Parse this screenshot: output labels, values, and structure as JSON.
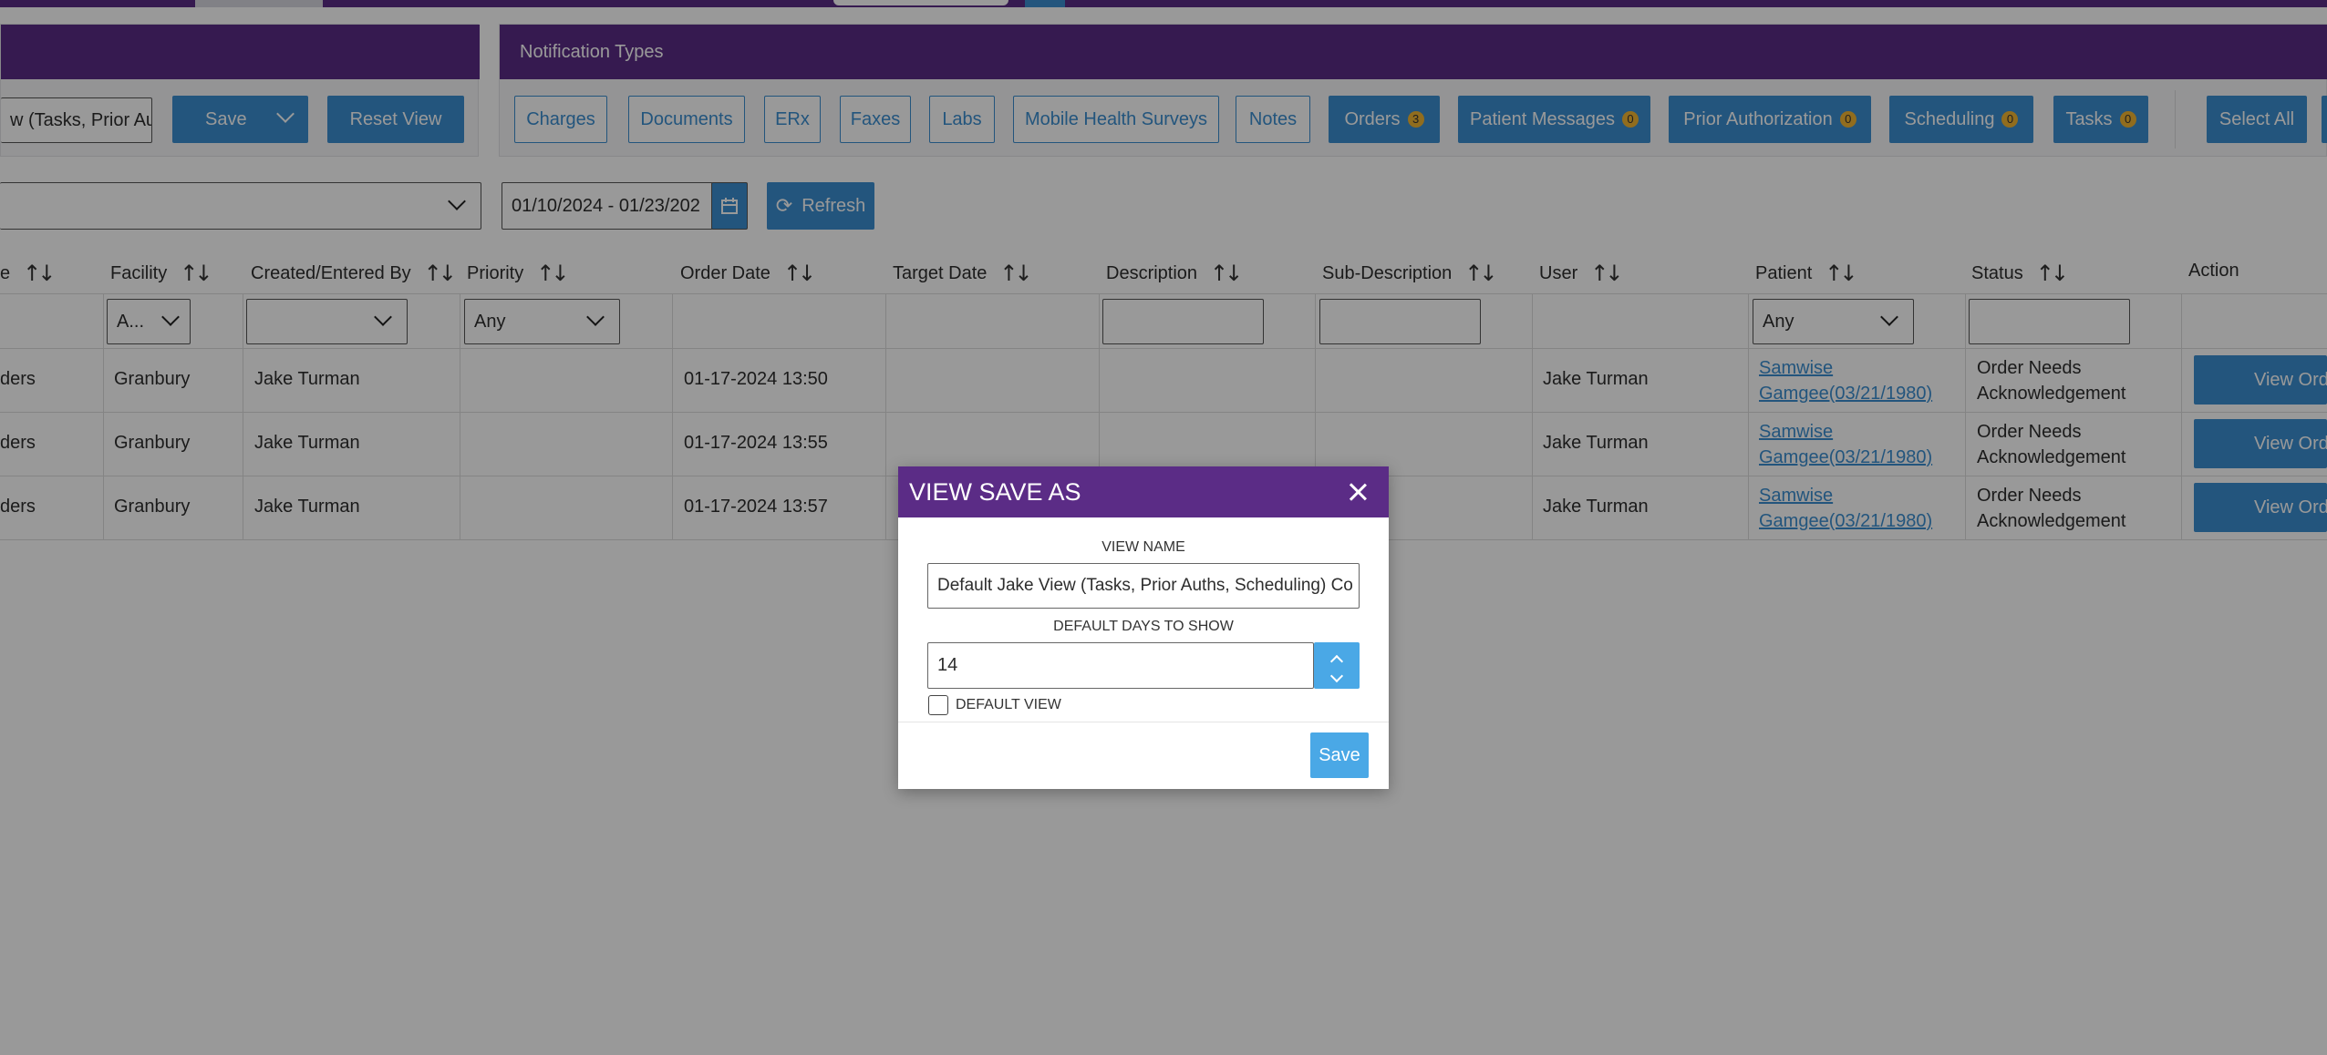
{
  "left_panel": {
    "view_input_value": "w (Tasks, Prior Aut",
    "save_label": "Save",
    "reset_view_label": "Reset View"
  },
  "notification_types": {
    "title": "Notification Types",
    "outline_buttons": [
      "Charges",
      "Documents",
      "ERx",
      "Faxes",
      "Labs",
      "Mobile Health Surveys",
      "Notes"
    ],
    "active_buttons": [
      {
        "label": "Orders",
        "count": "3"
      },
      {
        "label": "Patient Messages",
        "count": "0"
      },
      {
        "label": "Prior Authorization",
        "count": "0"
      },
      {
        "label": "Scheduling",
        "count": "0"
      },
      {
        "label": "Tasks",
        "count": "0"
      }
    ],
    "select_all_label": "Select All"
  },
  "filters": {
    "date_range": "01/10/2024 - 01/23/202",
    "refresh_label": "Refresh"
  },
  "columns": [
    "e",
    "Facility",
    "Created/Entered By",
    "Priority",
    "Order Date",
    "Target Date",
    "Description",
    "Sub-Description",
    "User",
    "Patient",
    "Status",
    "Action"
  ],
  "column_filters": {
    "facility": "A...",
    "priority": "Any",
    "patient": "Any"
  },
  "rows": [
    {
      "type": "ders",
      "facility": "Granbury",
      "created_by": "Jake Turman",
      "order_date": "01-17-2024 13:50",
      "user": "Jake Turman",
      "patient_line1": "Samwise",
      "patient_line2": "Gamgee(03/21/1980)",
      "status_line1": "Order Needs",
      "status_line2": "Acknowledgement",
      "action": "View Ord"
    },
    {
      "type": "ders",
      "facility": "Granbury",
      "created_by": "Jake Turman",
      "order_date": "01-17-2024 13:55",
      "user": "Jake Turman",
      "patient_line1": "Samwise",
      "patient_line2": "Gamgee(03/21/1980)",
      "status_line1": "Order Needs",
      "status_line2": "Acknowledgement",
      "action": "View Ord"
    },
    {
      "type": "ders",
      "facility": "Granbury",
      "created_by": "Jake Turman",
      "order_date": "01-17-2024 13:57",
      "user": "Jake Turman",
      "patient_line1": "Samwise",
      "patient_line2": "Gamgee(03/21/1980)",
      "status_line1": "Order Needs",
      "status_line2": "Acknowledgement",
      "action": "View Ord"
    }
  ],
  "modal": {
    "title": "VIEW SAVE AS",
    "view_name_label": "VIEW NAME",
    "view_name_value": "Default Jake View (Tasks, Prior Auths, Scheduling) Co",
    "days_label": "DEFAULT DAYS TO SHOW",
    "days_value": "14",
    "default_view_label": "DEFAULT VIEW",
    "save_label": "Save"
  },
  "colors": {
    "purple": "#5b2c86",
    "blue": "#3b8ed0",
    "light_blue": "#4aa8e6",
    "badge": "#f2b632"
  }
}
